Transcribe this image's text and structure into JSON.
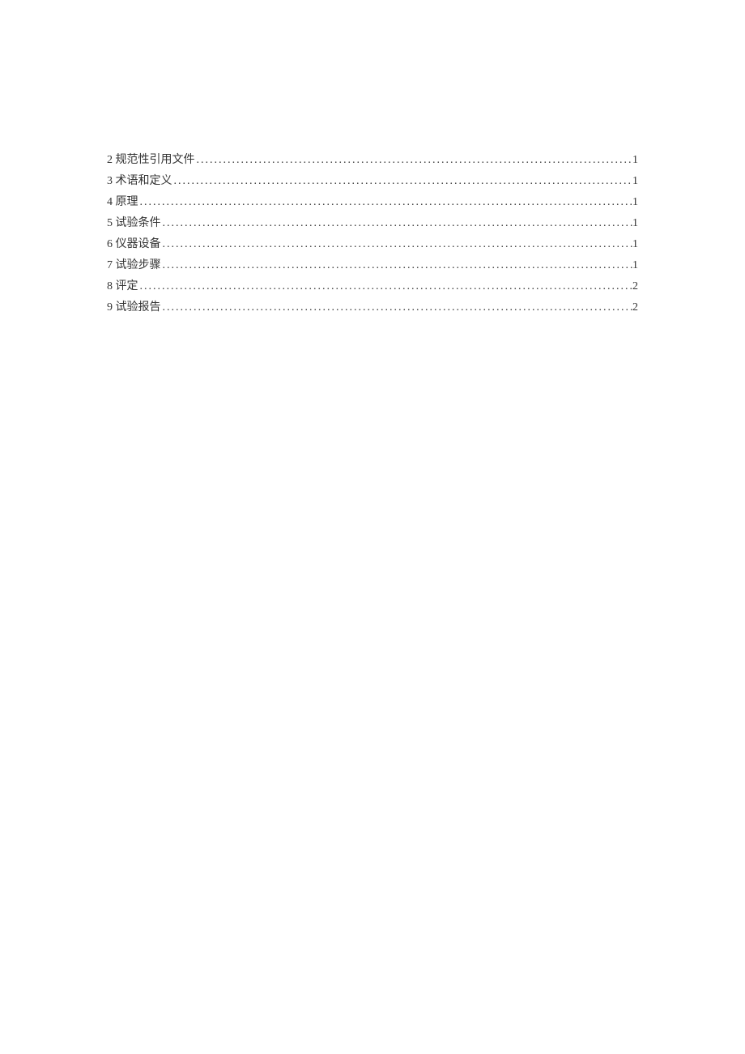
{
  "toc": {
    "entries": [
      {
        "label": "2 规范性引用文件",
        "page": "1"
      },
      {
        "label": "3 术语和定义",
        "page": "1"
      },
      {
        "label": "4 原理",
        "page": "1"
      },
      {
        "label": "5 试验条件",
        "page": "1"
      },
      {
        "label": "6 仪器设备",
        "page": "1"
      },
      {
        "label": "7 试验步骤",
        "page": "1"
      },
      {
        "label": "8 评定",
        "page": "2"
      },
      {
        "label": "9 试验报告",
        "page": "2"
      }
    ]
  }
}
